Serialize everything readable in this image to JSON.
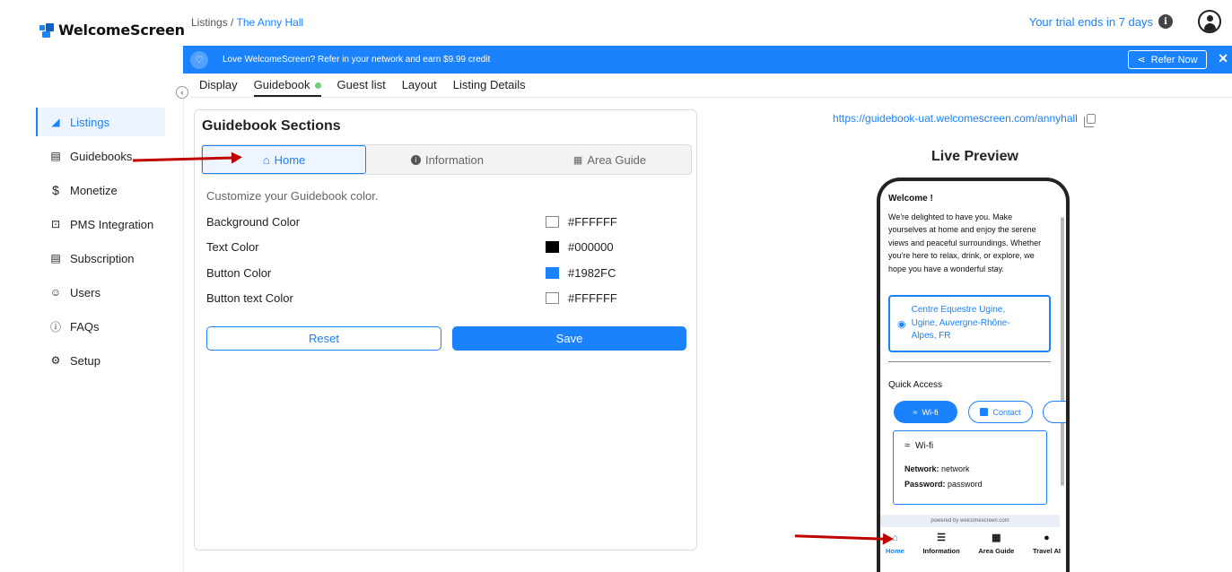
{
  "app": {
    "name": "WelcomeScreen",
    "brand_color": "#1982FC"
  },
  "sidebar": {
    "items": [
      {
        "label": "Listings",
        "icon": "listings-icon",
        "active": true
      },
      {
        "label": "Guidebooks",
        "icon": "book-icon",
        "active": false
      },
      {
        "label": "Monetize",
        "icon": "dollar-icon",
        "active": false
      },
      {
        "label": "PMS Integration",
        "icon": "plug-icon",
        "active": false
      },
      {
        "label": "Subscription",
        "icon": "subscription-icon",
        "active": false
      },
      {
        "label": "Users",
        "icon": "users-icon",
        "active": false
      },
      {
        "label": "FAQs",
        "icon": "question-icon",
        "active": false
      },
      {
        "label": "Setup",
        "icon": "gear-icon",
        "active": false
      }
    ]
  },
  "header": {
    "breadcrumb_root": "Listings",
    "breadcrumb_sep": " / ",
    "breadcrumb_current": "The Anny Hall",
    "trial_text": "Your trial ends in 7 days"
  },
  "banner": {
    "text": "Love WelcomeScreen? Refer in your network and earn $9.99 credit",
    "refer_label": "Refer Now",
    "close": "✕"
  },
  "tabs": [
    {
      "label": "Display",
      "active": false
    },
    {
      "label": "Guidebook",
      "active": true,
      "status_dot": "#6fd07a"
    },
    {
      "label": "Guest list",
      "active": false
    },
    {
      "label": "Layout",
      "active": false
    },
    {
      "label": "Listing Details",
      "active": false
    }
  ],
  "panel": {
    "title": "Guidebook Sections",
    "sections": [
      {
        "label": "Home",
        "icon": "home-icon",
        "active": true
      },
      {
        "label": "Information",
        "icon": "info-icon",
        "active": false
      },
      {
        "label": "Area Guide",
        "icon": "map-icon",
        "active": false
      }
    ],
    "customize_text": "Customize your Guidebook color.",
    "colors": [
      {
        "label": "Background Color",
        "value": "#FFFFFF"
      },
      {
        "label": "Text Color",
        "value": "#000000"
      },
      {
        "label": "Button Color",
        "value": "#1982FC"
      },
      {
        "label": "Button text Color",
        "value": "#FFFFFF"
      }
    ],
    "reset_label": "Reset",
    "save_label": "Save"
  },
  "preview": {
    "url": "https://guidebook-uat.welcomescreen.com/annyhall",
    "title": "Live Preview",
    "welcome": "Welcome !",
    "welcome_text": "We're delighted to have you. Make yourselves at home and enjoy the serene views and peaceful surroundings. Whether you're here to relax, drink, or explore, we hope you have a wonderful stay.",
    "location": "Centre Equestre Ugine, Ugine, Auvergne-Rhône-Alpes, FR",
    "quick_access": "Quick Access",
    "chips": [
      "Wi-fi",
      "Contact"
    ],
    "wifi_title": "Wi-fi",
    "network_label": "Network:",
    "network_value": "network",
    "password_label": "Password:",
    "password_value": "password",
    "powered_by": "powered by  welcomescreen.com",
    "nav": [
      {
        "label": "Home",
        "icon": "home-icon",
        "active": true
      },
      {
        "label": "Information",
        "icon": "list-icon",
        "active": false
      },
      {
        "label": "Area Guide",
        "icon": "map-icon",
        "active": false
      },
      {
        "label": "Travel AI",
        "icon": "circle-icon",
        "active": false
      }
    ]
  }
}
